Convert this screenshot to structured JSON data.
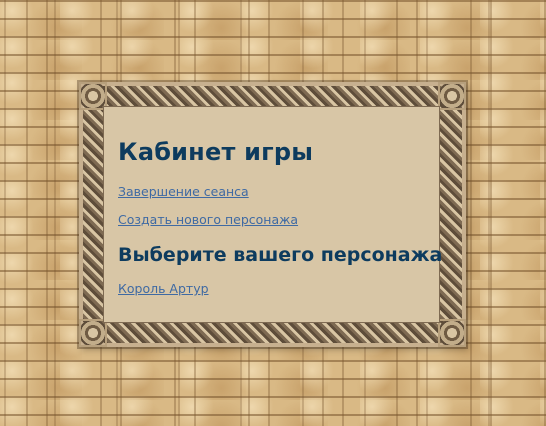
{
  "page": {
    "title": "Кабинет игры",
    "links": {
      "logout": "Завершение сеанса",
      "create_character": "Создать нового персонажа"
    },
    "choose_heading": "Выберите вашего персонажа",
    "characters": [
      "Король Артур"
    ]
  },
  "colors": {
    "heading": "#0d3b5e",
    "link": "#3f6aa3",
    "panel_bg": "#d8c6a6",
    "wall": "#d9b985"
  }
}
